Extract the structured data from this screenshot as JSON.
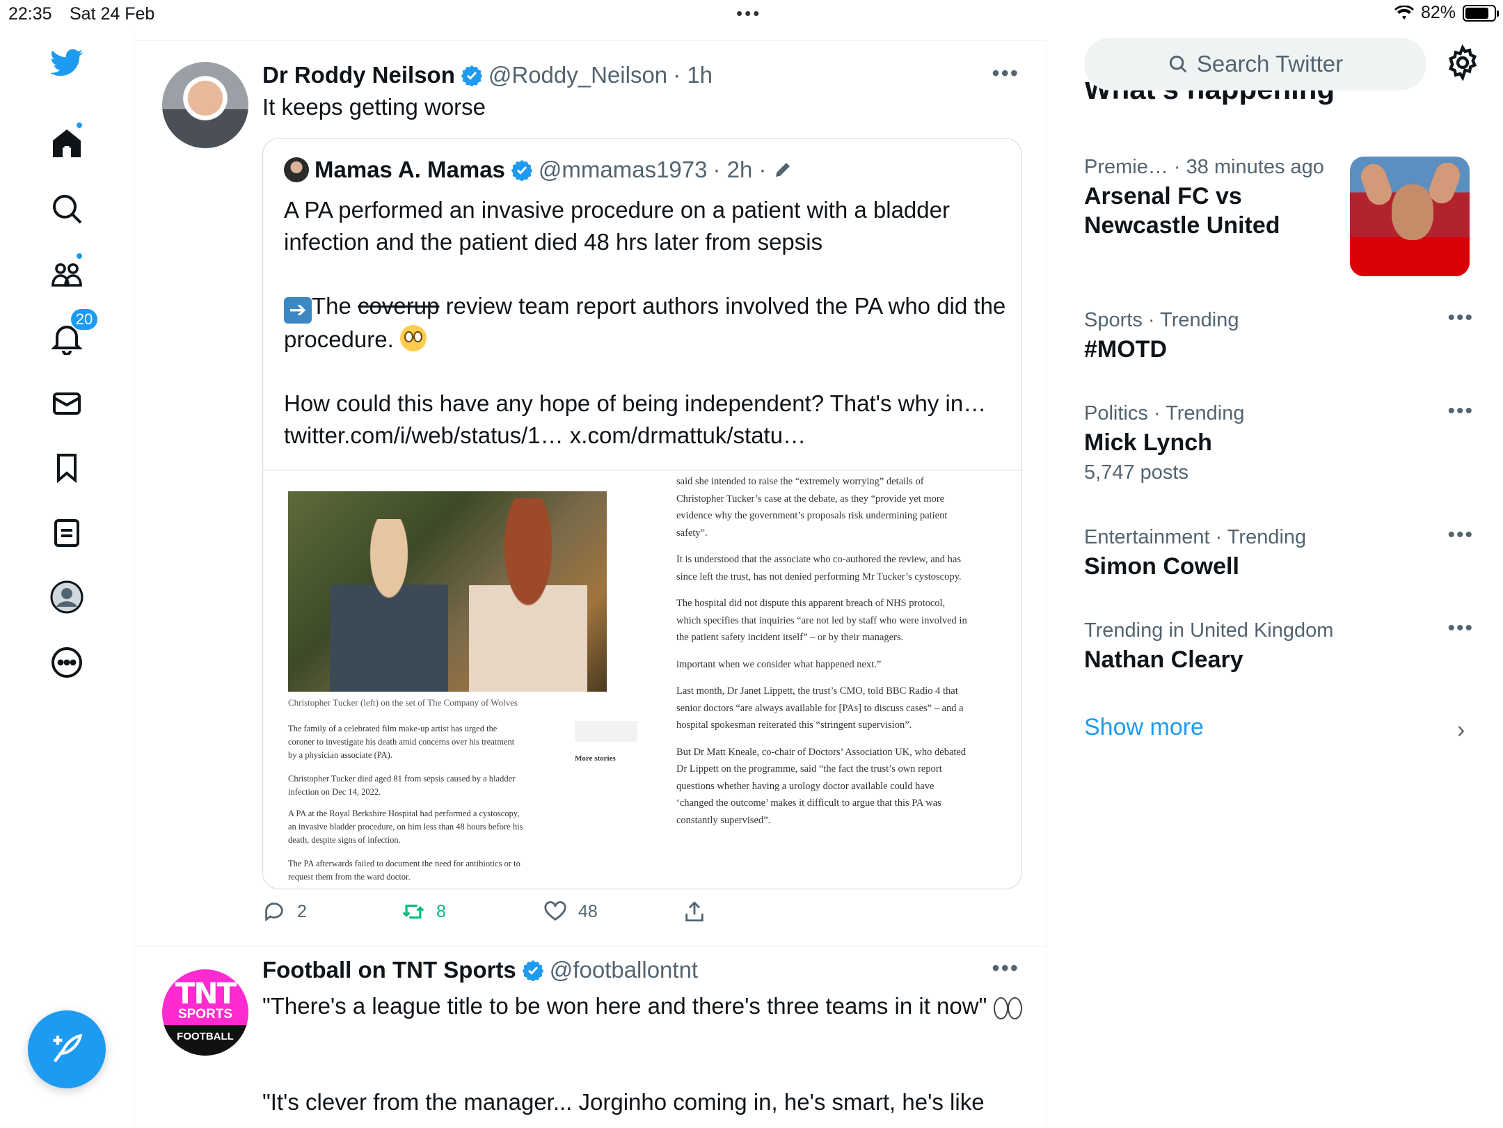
{
  "status": {
    "time": "22:35",
    "date": "Sat 24 Feb",
    "battery_pct": "82%",
    "battery_level": 0.82
  },
  "nav": {
    "items": [
      {
        "icon": "twitter-bird-icon"
      },
      {
        "icon": "home-icon",
        "has_dot": true
      },
      {
        "icon": "search-icon"
      },
      {
        "icon": "communities-icon",
        "has_dot": true
      },
      {
        "icon": "notifications-icon",
        "badge": "20"
      },
      {
        "icon": "messages-icon"
      },
      {
        "icon": "bookmarks-icon"
      },
      {
        "icon": "lists-icon"
      },
      {
        "icon": "profile-icon"
      },
      {
        "icon": "more-icon"
      }
    ],
    "compose_icon": "compose-feather-icon"
  },
  "tweets": [
    {
      "name": "Dr Roddy Neilson",
      "handle": "@Roddy_Neilson",
      "time": "· 1h",
      "text": "It keeps getting worse",
      "quote": {
        "name": "Mamas A. Mamas",
        "handle": "@mmamas1973",
        "time": "· 2h ·",
        "p1": "A PA performed an invasive procedure on a patient with a bladder infection and the patient died 48 hrs later from sepsis",
        "p2_prefix": "The ",
        "p2_strike": "coverup",
        "p2_rest": " review team report authors involved the PA who did the procedure. ",
        "p3": "How could this have any hope of being independent? That's why in… twitter.com/i/web/status/1… x.com/drmattuk/statu…",
        "article": {
          "caption": "Christopher Tucker (left) on the set of The Company of Wolves",
          "left_paras": [
            "The family of a celebrated film make-up artist has urged the coroner to investigate his death amid concerns over his treatment by a physician associate (PA).",
            "Christopher Tucker died aged 81 from sepsis caused by a bladder infection on Dec 14, 2022.",
            "A PA at the Royal Berkshire Hospital had performed a cystoscopy, an invasive bladder procedure, on him less than 48 hours before his death, despite signs of infection.",
            "The PA afterwards failed to document the need for antibiotics or to request them from the ward doctor."
          ],
          "more_stories": "More stories",
          "right_paras": [
            "said she intended to raise the “extremely worrying” details of Christopher Tucker’s case at the debate, as they “provide yet more evidence why the government’s proposals risk undermining patient safety”.",
            "It is understood that the associate who co-authored the review, and has since left the trust, has not denied performing Mr Tucker’s cystoscopy.",
            "The hospital did not dispute this apparent breach of NHS protocol, which specifies that inquiries “are not led by staff who were involved in the patient safety incident itself” – or by their managers.",
            "important when we consider what happened next.”",
            "Last month, Dr Janet Lippett, the trust’s CMO, told BBC Radio 4 that senior doctors “are always available for [PAs] to discuss cases” – and a hospital spokesman reiterated this “stringent supervision”.",
            "But Dr Matt Kneale, co-chair of Doctors’ Association UK, who debated Dr Lippett on the programme, said “the fact the trust’s own report questions whether having a urology doctor available could have ‘changed the outcome’ makes it difficult to argue that this PA was constantly supervised”."
          ]
        }
      },
      "replies": "2",
      "retweets": "8",
      "likes": "48"
    },
    {
      "name": "Football on TNT Sports",
      "handle": "@footballontnt",
      "text1": "\"There's a league title to be won here and there's three teams in it now\"",
      "text2": "\"It's clever from the manager... Jorginho coming in, he's smart, he's like",
      "avatar": {
        "tnt": "TNT",
        "sports": "SPORTS",
        "football": "FOOTBALL"
      }
    }
  ],
  "sidebar": {
    "search_placeholder": "Search Twitter",
    "heading": "What’s happening",
    "trends": [
      {
        "meta_cat": "Premie…",
        "meta_time": "· 38 minutes ago",
        "title": "Arsenal FC vs Newcastle United",
        "sub": ""
      },
      {
        "meta_cat": "Sports · Trending",
        "meta_time": "",
        "title": "#MOTD",
        "sub": ""
      },
      {
        "meta_cat": "Politics · Trending",
        "meta_time": "",
        "title": "Mick Lynch",
        "sub": "5,747 posts"
      },
      {
        "meta_cat": "Entertainment · Trending",
        "meta_time": "",
        "title": "Simon Cowell",
        "sub": ""
      },
      {
        "meta_cat": "Trending in United Kingdom",
        "meta_time": "",
        "title": "Nathan Cleary",
        "sub": ""
      }
    ],
    "show_more": "Show more"
  },
  "colors": {
    "accent": "#1d9bf0",
    "retweet": "#00ba7c",
    "secondary_text": "#536471"
  }
}
